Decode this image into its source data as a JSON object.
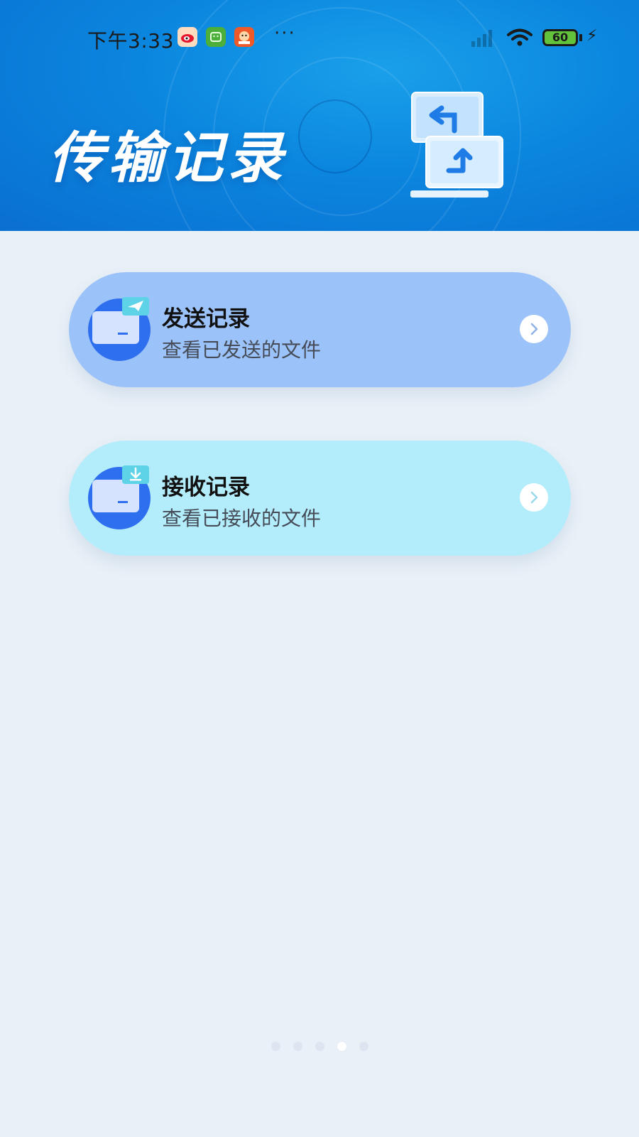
{
  "status_bar": {
    "time": "下午3:33",
    "battery_level": "60",
    "more_label": "···",
    "app_icons": [
      "weibo-icon",
      "green-app-icon",
      "cartoon-app-icon"
    ]
  },
  "header": {
    "title": "传输记录",
    "illustration": "transfer-computer-icon"
  },
  "records": [
    {
      "title": "发送记录",
      "subtitle": "查看已发送的文件",
      "icon": "send-record-icon",
      "accent": "#9cc2fa"
    },
    {
      "title": "接收记录",
      "subtitle": "查看已接收的文件",
      "icon": "receive-record-icon",
      "accent": "#b3ecfb"
    }
  ],
  "pager": {
    "count": 5,
    "active_index": 3
  },
  "colors": {
    "header_blue": "#0b86df",
    "background": "#e9f0f7",
    "icon_blue": "#2e6ff0"
  }
}
